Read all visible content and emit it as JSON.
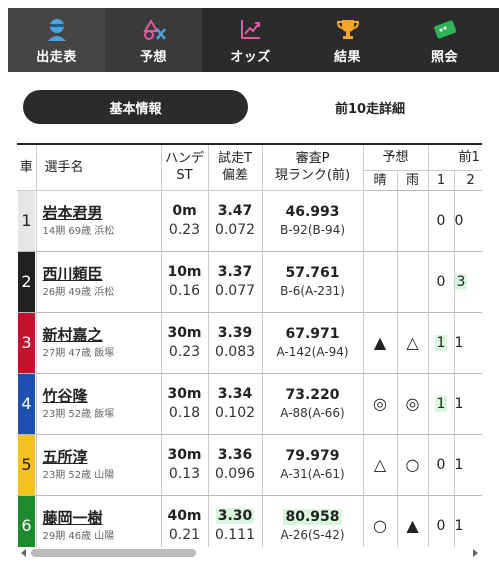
{
  "nav": {
    "items": [
      {
        "label": "出走表",
        "icon": "racer-icon"
      },
      {
        "label": "予想",
        "icon": "prediction-icon"
      },
      {
        "label": "オッズ",
        "icon": "chart-icon"
      },
      {
        "label": "結果",
        "icon": "trophy-icon"
      },
      {
        "label": "照会",
        "icon": "ticket-icon"
      }
    ]
  },
  "tabs": {
    "basic": "基本情報",
    "last10": "前10走詳細"
  },
  "table": {
    "headers": {
      "car": "車",
      "name": "選手名",
      "handicap_line1": "ハンデ",
      "handicap_line2": "ST",
      "trial_line1": "試走T",
      "trial_line2": "偏差",
      "score_line1": "審査P",
      "score_line2": "現ランク(前)",
      "forecast": "予想",
      "forecast_sunny": "晴",
      "forecast_rain": "雨",
      "prev": "前1",
      "prev_col1": "1",
      "prev_col2": "2"
    },
    "rows": [
      {
        "num": "1",
        "name": "岩本君男",
        "info": "14期 69歳 浜松",
        "handicap": "0m",
        "st": "0.23",
        "trial": "3.47",
        "dev": "0.072",
        "score": "46.993",
        "rank": "B-92(B-94)",
        "sunny": "",
        "rain": "",
        "p1": "0",
        "p2": "0"
      },
      {
        "num": "2",
        "name": "西川頼臣",
        "info": "26期 49歳 浜松",
        "handicap": "10m",
        "st": "0.16",
        "trial": "3.37",
        "dev": "0.077",
        "score": "57.761",
        "rank": "B-6(A-231)",
        "sunny": "",
        "rain": "",
        "p1": "0",
        "p2": "3"
      },
      {
        "num": "3",
        "name": "新村嘉之",
        "info": "27期 47歳 飯塚",
        "handicap": "30m",
        "st": "0.23",
        "trial": "3.39",
        "dev": "0.083",
        "score": "67.971",
        "rank": "A-142(A-94)",
        "sunny": "▲",
        "rain": "△",
        "p1": "1",
        "p2": "1"
      },
      {
        "num": "4",
        "name": "竹谷隆",
        "info": "23期 52歳 飯塚",
        "handicap": "30m",
        "st": "0.18",
        "trial": "3.34",
        "dev": "0.102",
        "score": "73.220",
        "rank": "A-88(A-66)",
        "sunny": "◎",
        "rain": "◎",
        "p1": "1",
        "p2": "1"
      },
      {
        "num": "5",
        "name": "五所淳",
        "info": "23期 52歳 山陽",
        "handicap": "30m",
        "st": "0.13",
        "trial": "3.36",
        "dev": "0.096",
        "score": "79.979",
        "rank": "A-31(A-61)",
        "sunny": "△",
        "rain": "○",
        "p1": "0",
        "p2": "1"
      },
      {
        "num": "6",
        "name": "藤岡一樹",
        "info": "29期 46歳 山陽",
        "handicap": "40m",
        "st": "0.21",
        "trial": "3.30",
        "dev": "0.111",
        "score": "80.958",
        "rank": "A-26(S-42)",
        "sunny": "○",
        "rain": "▲",
        "p1": "0",
        "p2": "1"
      }
    ]
  },
  "colors": {
    "nav_bg": "#2b2b2b",
    "highlight": "#d9f6df",
    "car1": "#e6e6e6",
    "car2": "#222222",
    "car3": "#c8102e",
    "car4": "#1f4fb0",
    "car5": "#f5c21b",
    "car6": "#1e8a2e"
  }
}
